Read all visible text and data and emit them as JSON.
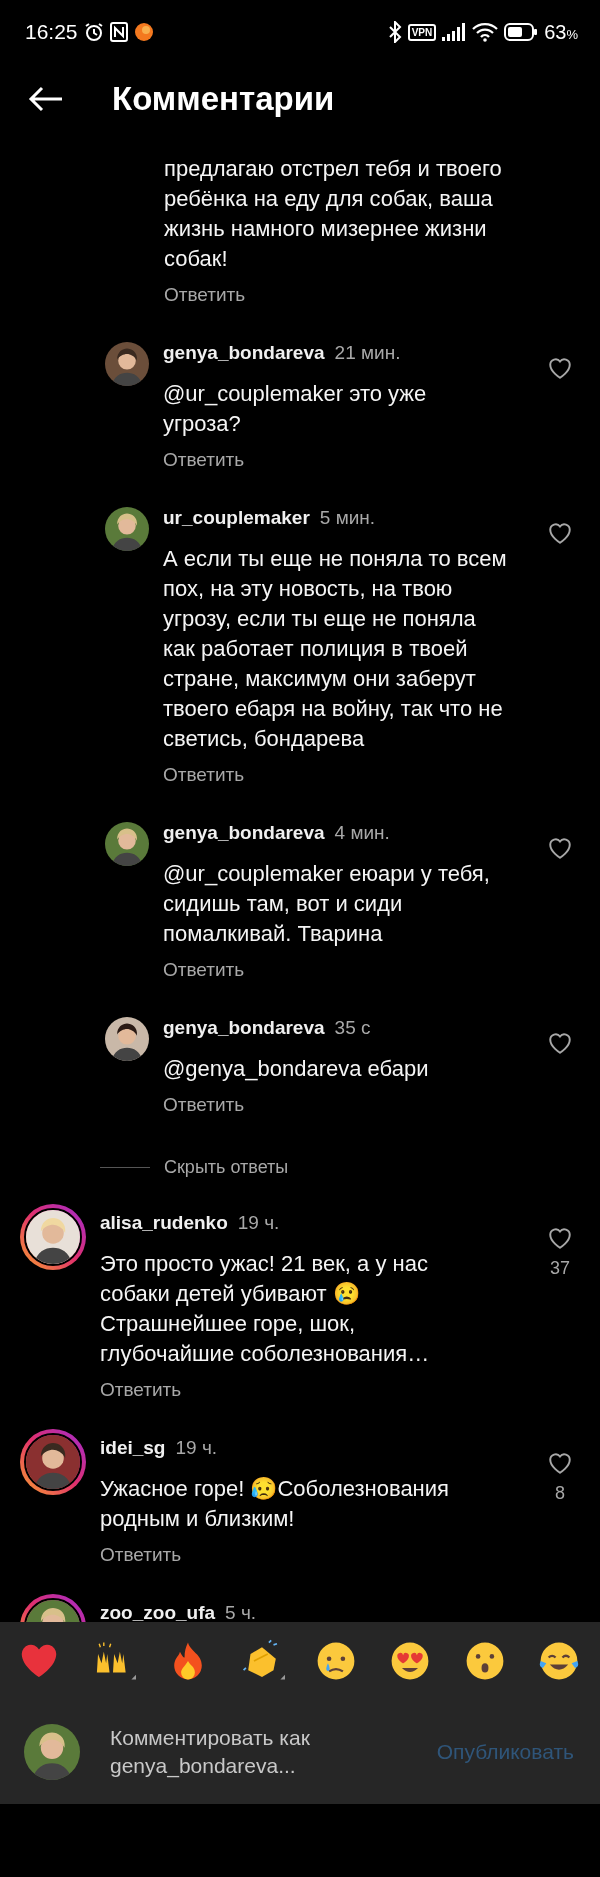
{
  "status_bar": {
    "time": "16:25",
    "vpn": "VPN",
    "battery": "63",
    "battery_unit": "%"
  },
  "header": {
    "title": "Комментарии"
  },
  "comments": [
    {
      "kind": "tail",
      "text": "предлагаю отстрел тебя и твоего ребёнка на еду для собак, ваша жизнь намного мизернее жизни собак!",
      "reply": "Ответить"
    },
    {
      "kind": "reply",
      "username": "genya_bondareva",
      "time": "21 мин.",
      "text": "@ur_couplemaker это уже угроза?",
      "reply": "Ответить",
      "story_ring": false
    },
    {
      "kind": "reply",
      "username": "ur_couplemaker",
      "time": "5 мин.",
      "text": "А если ты еще не поняла то всем пох, на эту новость, на твою угрозу, если ты еще не поняла как работает полиция в твоей стране, максимум они заберут твоего ебаря на войну, так что не светись, бондарева",
      "reply": "Ответить",
      "story_ring": false
    },
    {
      "kind": "reply",
      "username": "genya_bondareva",
      "time": "4 мин.",
      "text": "@ur_couplemaker еюари у тебя, сидишь там, вот и сиди помалкивай. Тварина",
      "reply": "Ответить",
      "story_ring": false
    },
    {
      "kind": "reply",
      "username": "genya_bondareva",
      "time": "35 с",
      "text": "@genya_bondareva ебари",
      "reply": "Ответить",
      "story_ring": false
    },
    {
      "kind": "hide",
      "label": "Скрыть ответы"
    },
    {
      "kind": "comment",
      "username": "alisa_rudenko",
      "time": "19 ч.",
      "text": "Это просто ужас! 21 век, а у нас собаки детей убивают 😢 Страшнейшее горе, шок, глубочайшие соболезнования…",
      "reply": "Ответить",
      "likes": "37",
      "story_ring": true
    },
    {
      "kind": "comment",
      "username": "idei_sg",
      "time": "19 ч.",
      "text": "Ужасное горе! 😥Соболезнования родным и близким!",
      "reply": "Ответить",
      "likes": "8",
      "story_ring": true
    },
    {
      "kind": "comment",
      "username": "zoo_zoo_ufa",
      "time": "5 ч.",
      "story_ring": true
    }
  ],
  "reactions": [
    {
      "kind": "heart"
    },
    {
      "kind": "raised_hands"
    },
    {
      "kind": "fire"
    },
    {
      "kind": "clap"
    },
    {
      "kind": "cry"
    },
    {
      "kind": "heart_eyes"
    },
    {
      "kind": "wow"
    },
    {
      "kind": "joy"
    }
  ],
  "composer": {
    "placeholder": "Комментировать как genya_bondareva...",
    "post": "Опубликовать"
  }
}
